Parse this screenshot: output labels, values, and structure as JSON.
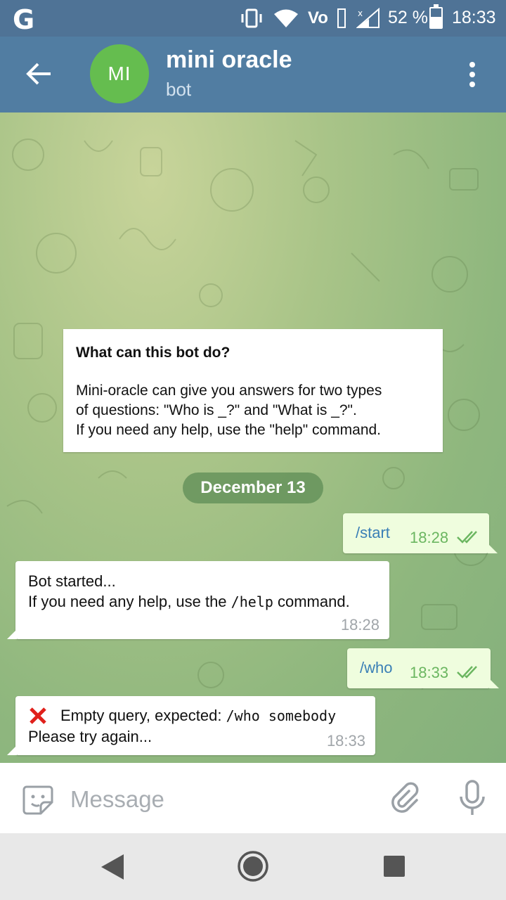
{
  "status_bar": {
    "carrier_icon": "google-g-icon",
    "battery": "52 %",
    "time": "18:33",
    "network_label": "Vo"
  },
  "header": {
    "avatar_initials": "MI",
    "avatar_color": "#65bd4f",
    "title": "mini oracle",
    "subtitle": "bot"
  },
  "bot_info": {
    "heading": "What can this bot do?",
    "line1": "Mini-oracle can give you answers for two types",
    "line2": "of questions: \"Who is _?\" and \"What is _?\".",
    "line3": "If you need any help, use the \"help\" command."
  },
  "date_separator": "December 13",
  "messages": [
    {
      "direction": "out",
      "text": "/start",
      "time": "18:28"
    },
    {
      "direction": "in",
      "line1": "Bot started...",
      "line2_pre": "If you need any help, use the ",
      "line2_code": "/help",
      "line2_post": " command.",
      "time": "18:28"
    },
    {
      "direction": "out",
      "text": "/who",
      "time": "18:33"
    },
    {
      "direction": "in",
      "line1_pre": "Empty query, expected: ",
      "line1_code": "/who somebody",
      "line2": "Please try again...",
      "time": "18:33"
    }
  ],
  "input": {
    "placeholder": "Message"
  },
  "colors": {
    "status_bar": "#4f7396",
    "header": "#517da2",
    "outgoing_bubble": "#effdde",
    "link": "#3a7fb6",
    "check": "#6bb660"
  }
}
